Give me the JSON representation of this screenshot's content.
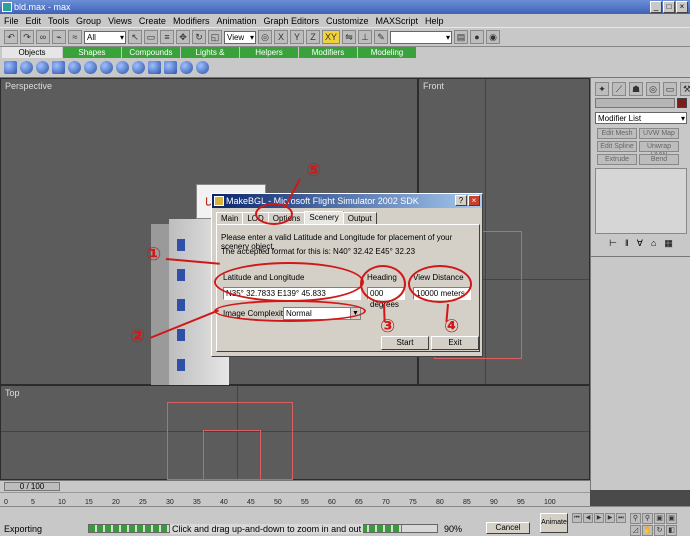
{
  "window": {
    "title": "bld.max - max"
  },
  "menubar": {
    "items": [
      "File",
      "Edit",
      "Tools",
      "Group",
      "Views",
      "Create",
      "Modifiers",
      "Animation",
      "Graph Editors",
      "Customize",
      "MAXScript",
      "Help"
    ]
  },
  "toolbar": {
    "selection_filter": "All",
    "reference_coord": "View",
    "xy_label": "XY"
  },
  "tabs": [
    "Objects",
    "Shapes",
    "Compounds",
    "Lights & Cameras",
    "Helpers",
    "Modifiers",
    "Modeling"
  ],
  "viewports": {
    "perspective": "Perspective",
    "front": "Front",
    "top": "Top"
  },
  "building": {
    "sign_text": "しろくま航空"
  },
  "dialog": {
    "title": "MakeBGL - Microsoft Flight Simulator 2002 SDK",
    "tabs": [
      "Main",
      "LOD",
      "Options",
      "Scenery",
      "Output"
    ],
    "instruction": "Please enter a valid Latitude and Longitude for placement of your scenery object.",
    "format_note": "The accepted format for this is: N40° 32.42 E45° 32.23",
    "lat_lon_label": "Latitude and Longitude",
    "lat_lon_value": "N35° 32.7833 E139° 45.833",
    "heading_label": "Heading",
    "heading_value": "000 degrees",
    "view_distance_label": "View Distance",
    "view_distance_value": "10000 meters",
    "image_complexity_label": "Image Complexity",
    "image_complexity_value": "Normal",
    "start_button": "Start",
    "exit_button": "Exit"
  },
  "annotations": [
    "①",
    "②",
    "③",
    "④",
    "⑤"
  ],
  "command_panel": {
    "modifier_list": "Modifier List",
    "buttons": [
      "Edit Mesh",
      "UVW Map",
      "Edit Spline",
      "Unwrap UVW",
      "Extrude",
      "Bend"
    ]
  },
  "timeline": {
    "slider_label": "0 / 100",
    "ticks": [
      "0",
      "5",
      "10",
      "15",
      "20",
      "25",
      "30",
      "35",
      "40",
      "45",
      "50",
      "55",
      "60",
      "65",
      "70",
      "75",
      "80",
      "85",
      "90",
      "95",
      "100"
    ]
  },
  "status": {
    "exporting": "Exporting",
    "hint": "Click and drag up-and-down to zoom in and out",
    "progress_text": "90%",
    "progress": 0.9,
    "cancel": "Cancel",
    "animate": "Animate"
  }
}
